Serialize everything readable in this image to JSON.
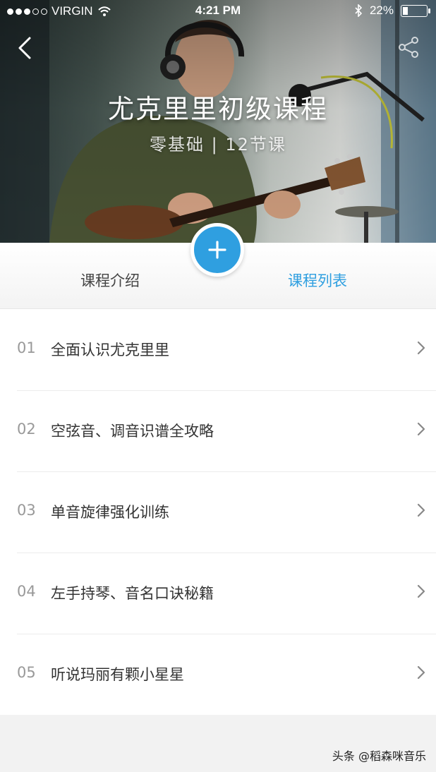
{
  "status_bar": {
    "carrier": "VIRGIN",
    "time": "4:21 PM",
    "battery": "22%",
    "battery_level": 0.22,
    "signal_icon": "signal-dots-icon",
    "wifi_icon": "wifi-icon",
    "bluetooth_icon": "bluetooth-icon"
  },
  "header": {
    "back_icon": "chevron-left-icon",
    "share_icon": "share-icon",
    "title": "尤克里里初级课程",
    "subtitle": "零基础 | 12节课"
  },
  "tabs": [
    {
      "label": "课程介绍",
      "active": false
    },
    {
      "label": "课程列表",
      "active": true
    }
  ],
  "fab": {
    "icon": "plus-icon",
    "color": "#2f9fe0"
  },
  "accent_color": "#2f9fe0",
  "lessons": [
    {
      "number": "01",
      "title": "全面认识尤克里里"
    },
    {
      "number": "02",
      "title": "空弦音、调音识谱全攻略"
    },
    {
      "number": "03",
      "title": "单音旋律强化训练"
    },
    {
      "number": "04",
      "title": "左手持琴、音名口诀秘籍"
    },
    {
      "number": "05",
      "title": "听说玛丽有颗小星星"
    }
  ],
  "watermark": "头条 @稻森咪音乐"
}
